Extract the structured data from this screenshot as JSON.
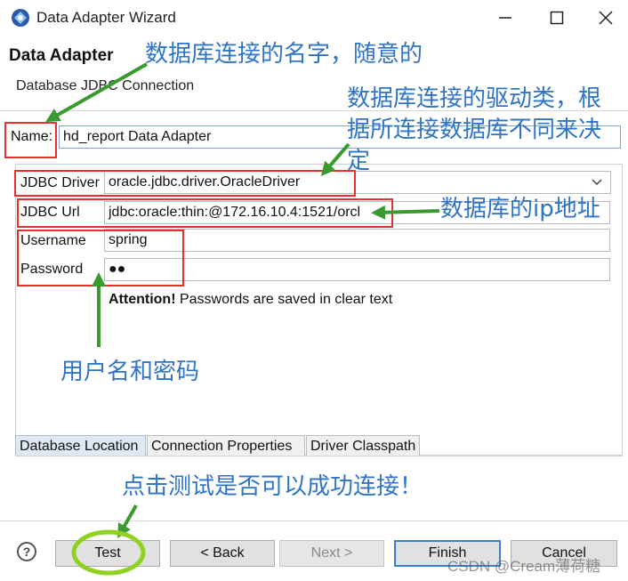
{
  "window": {
    "title": "Data Adapter Wizard",
    "icon": "eclipse-data-adapter-icon",
    "controls": [
      "minimize-icon",
      "maximize-icon",
      "close-icon"
    ]
  },
  "header": {
    "title": "Data Adapter",
    "subtitle": "Database JDBC Connection"
  },
  "form": {
    "name_label": "Name:",
    "name_value": "hd_report Data Adapter",
    "driver_label": "JDBC Driver",
    "driver_value": "oracle.jdbc.driver.OracleDriver",
    "url_label": "JDBC Url",
    "url_value": "jdbc:oracle:thin:@172.16.10.4:1521/orcl",
    "username_label": "Username",
    "username_value": "spring",
    "password_label": "Password",
    "password_value": "●●",
    "attention_bold": "Attention!",
    "attention_text": " Passwords are saved in clear text"
  },
  "tabs": [
    {
      "label": "Database Location",
      "active": true
    },
    {
      "label": "Connection Properties",
      "active": false
    },
    {
      "label": "Driver Classpath",
      "active": false
    }
  ],
  "buttons": {
    "test": "Test",
    "back": "< Back",
    "next": "Next >",
    "finish": "Finish",
    "cancel": "Cancel"
  },
  "annotations": {
    "name_note": "数据库连接的名字，随意的",
    "driver_note_1": "数据库连接的驱动类，根",
    "driver_note_2": "据所连接数据库不同来决",
    "driver_note_3": "定",
    "url_note": "数据库的ip地址",
    "credentials_note": "用户名和密码",
    "test_note": "点击测试是否可以成功连接！"
  },
  "watermark": "CSDN @Cream薄荷糖",
  "colors": {
    "annotation_text": "#2f74c7",
    "arrow": "#3a9a2f",
    "red_box": "#e8302c",
    "test_circle": "#8fd11e",
    "field_border": "#7aa7d8"
  }
}
